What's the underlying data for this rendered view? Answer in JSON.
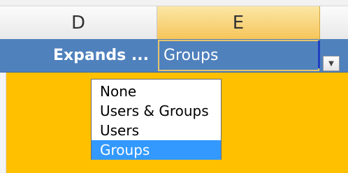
{
  "columns": {
    "d": "D",
    "e": "E"
  },
  "header_row": {
    "d_label": "Expands ...",
    "e_value": "Groups"
  },
  "dropdown": {
    "options": [
      "None",
      "Users & Groups",
      "Users",
      "Groups"
    ],
    "selected": "Groups",
    "selection_color": "#3399ff"
  },
  "colors": {
    "fill": "#ffc000",
    "header": "#4f81bd"
  }
}
